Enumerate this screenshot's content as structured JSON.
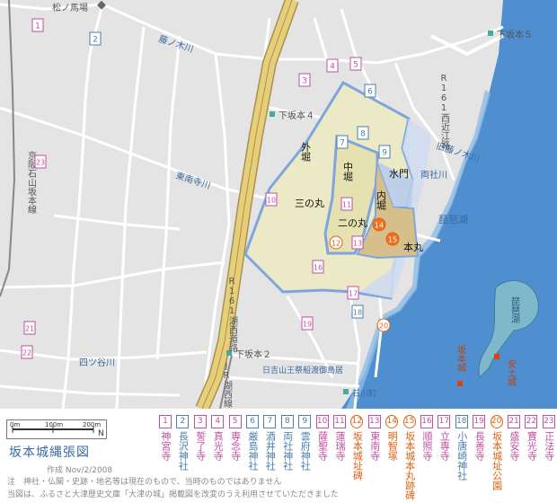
{
  "map": {
    "places": {
      "matsunobaba": "松ノ馬場",
      "shimosakamoto5": "下坂本５",
      "shimosakamoto4": "下坂本４",
      "shimosakamoto2": "下坂本２",
      "r161_nishiomi": "R161西近江路",
      "r161_kosei": "R161湖西道路",
      "jr_kosei": "JR湖西線",
      "keihan_line": "京阪石山坂本線",
      "hiyoshi": "日吉山王祭船渡御島居",
      "ishikawacho": "石川町",
      "yasuzuka": "安土城",
      "sakamoto_castle": "坂本城"
    },
    "rivers": {
      "fujinoki": "藤ノ木川",
      "kyu_fujinoki": "旧藤ノ木川",
      "tonan": "東南寺川",
      "shishiya": "四ツ谷川",
      "ryoyashiro": "両社川",
      "biwako_main": "琵琶湖",
      "biwako_inset": "琵琶湖"
    },
    "zones": {
      "sotobori": "外堀",
      "nakabori": "中堀",
      "uchibori": "内堀",
      "sannomaru": "三の丸",
      "ninomaru": "二の丸",
      "honmaru": "本丸",
      "mizumon": "水門"
    },
    "markers": [
      "1",
      "2",
      "3",
      "4",
      "5",
      "6",
      "7",
      "8",
      "9",
      "10",
      "11",
      "12",
      "13",
      "14",
      "15",
      "16",
      "17",
      "18",
      "19",
      "20",
      "21",
      "22",
      "23"
    ]
  },
  "legend": {
    "scale_labels": [
      "0m",
      "100m",
      "200m"
    ],
    "north": "N",
    "title": "坂本城縄張図",
    "author": "作成 Nov/2/2008",
    "note_lines": [
      "注　神社・仏閣・史跡・地名等は現在のもので、当時のものではありません",
      "当図は、ふるさと大津歴史文庫「大津の城」掲載図を改変のうえ利用させていただきました"
    ],
    "items": [
      {
        "num": "1",
        "name": "神宮寺",
        "color": "#c050a0"
      },
      {
        "num": "2",
        "name": "長沢神社",
        "color": "#4a7fb0"
      },
      {
        "num": "3",
        "name": "誓了寺",
        "color": "#c050a0"
      },
      {
        "num": "4",
        "name": "真光寺",
        "color": "#c050a0"
      },
      {
        "num": "5",
        "name": "専念寺",
        "color": "#c050a0"
      },
      {
        "num": "6",
        "name": "厳島神社",
        "color": "#4a7fb0"
      },
      {
        "num": "7",
        "name": "酒井神社",
        "color": "#4a7fb0"
      },
      {
        "num": "8",
        "name": "両社神社",
        "color": "#4a7fb0"
      },
      {
        "num": "9",
        "name": "雲府神社",
        "color": "#4a7fb0"
      },
      {
        "num": "10",
        "name": "薩聖寺",
        "color": "#c050a0"
      },
      {
        "num": "11",
        "name": "蓮瑞寺",
        "color": "#c050a0"
      },
      {
        "num": "12",
        "name": "坂本城址碑",
        "color": "#e06010"
      },
      {
        "num": "13",
        "name": "東南寺",
        "color": "#c050a0"
      },
      {
        "num": "14",
        "name": "明智塚",
        "color": "#e06010"
      },
      {
        "num": "15",
        "name": "坂本城本丸跡碑",
        "color": "#e06010"
      },
      {
        "num": "16",
        "name": "順照寺",
        "color": "#c050a0"
      },
      {
        "num": "17",
        "name": "立専寺",
        "color": "#c050a0"
      },
      {
        "num": "18",
        "name": "小唐崎神社",
        "color": "#4a7fb0"
      },
      {
        "num": "19",
        "name": "長善寺",
        "color": "#c050a0"
      },
      {
        "num": "20",
        "name": "坂本城址公園",
        "color": "#e06010"
      },
      {
        "num": "21",
        "name": "盛安寺",
        "color": "#c050a0"
      },
      {
        "num": "22",
        "name": "寶光寺",
        "color": "#c050a0"
      },
      {
        "num": "23",
        "name": "正法寺",
        "color": "#c050a0"
      }
    ]
  },
  "colors": {
    "temple": "#c050a0",
    "shrine": "#4a7fb0",
    "historic": "#e06010",
    "lake": "#4f8fd0",
    "road_major": "#d4b660",
    "moat": "#7fa6dc",
    "sannomaru_fill": "#ece9c6",
    "ninomaru_fill": "#e6e1b1",
    "honmaru_fill": "#d6bf8a"
  }
}
